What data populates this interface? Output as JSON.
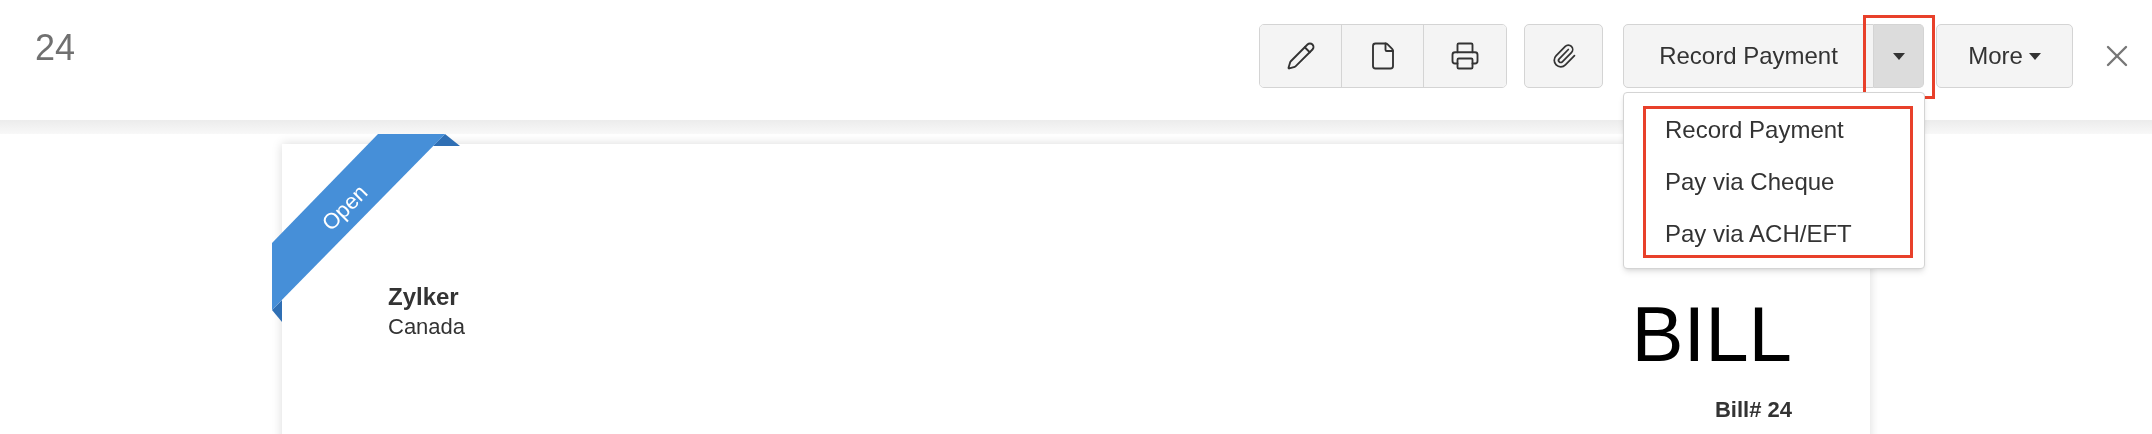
{
  "title": "24",
  "primary_action": {
    "label": "Record Payment",
    "menu_open": true,
    "caret_highlighted": true
  },
  "more_button": {
    "label": "More"
  },
  "action_menu": {
    "highlighted": true,
    "items": [
      {
        "label": "Record Payment"
      },
      {
        "label": "Pay via Cheque"
      },
      {
        "label": "Pay via ACH/EFT"
      }
    ]
  },
  "bill": {
    "status_ribbon": "Open",
    "vendor_name": "Zylker",
    "vendor_country": "Canada",
    "heading": "BILL",
    "number": "Bill# 24"
  }
}
